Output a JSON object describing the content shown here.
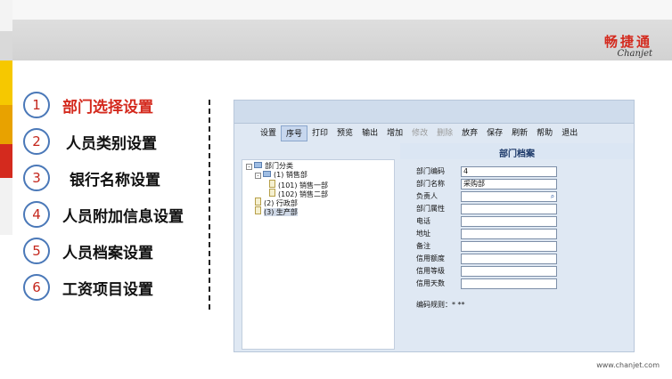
{
  "brand": {
    "name_cn": "畅捷通",
    "name_en": "Chanjet"
  },
  "menu": [
    {
      "number": "1",
      "label": "部门选择设置",
      "active": true
    },
    {
      "number": "2",
      "label": "人员类别设置",
      "active": false
    },
    {
      "number": "3",
      "label": "银行名称设置",
      "active": false
    },
    {
      "number": "4",
      "label": "人员附加信息设置",
      "active": false
    },
    {
      "number": "5",
      "label": "人员档案设置",
      "active": false
    },
    {
      "number": "6",
      "label": "工资项目设置",
      "active": false
    }
  ],
  "app": {
    "toolbar": [
      {
        "label": "设置",
        "state": "normal"
      },
      {
        "label": "序号",
        "state": "selected"
      },
      {
        "label": "打印",
        "state": "normal"
      },
      {
        "label": "预览",
        "state": "normal"
      },
      {
        "label": "输出",
        "state": "normal"
      },
      {
        "label": "增加",
        "state": "normal"
      },
      {
        "label": "修改",
        "state": "disabled"
      },
      {
        "label": "删除",
        "state": "disabled"
      },
      {
        "label": "放弃",
        "state": "normal"
      },
      {
        "label": "保存",
        "state": "normal"
      },
      {
        "label": "刷新",
        "state": "normal"
      },
      {
        "label": "帮助",
        "state": "normal"
      },
      {
        "label": "退出",
        "state": "normal"
      }
    ],
    "title": "部门档案",
    "tree": [
      {
        "text": "部门分类",
        "level": 0,
        "toggle": "-",
        "icon": "blue",
        "selected": false
      },
      {
        "text": "(1) 销售部",
        "level": 1,
        "toggle": "-",
        "icon": "blue",
        "selected": false
      },
      {
        "text": "(101) 销售一部",
        "level": 2,
        "toggle": "",
        "icon": "file",
        "selected": false
      },
      {
        "text": "(102) 销售二部",
        "level": 2,
        "toggle": "",
        "icon": "file",
        "selected": false
      },
      {
        "text": "(2) 行政部",
        "level": 1,
        "toggle": "",
        "icon": "file",
        "selected": false
      },
      {
        "text": "(3) 生产部",
        "level": 1,
        "toggle": "",
        "icon": "file",
        "selected": true
      }
    ],
    "form": {
      "fields": [
        {
          "label": "部门编码",
          "value": "4",
          "lookup": false
        },
        {
          "label": "部门名称",
          "value": "采购部",
          "lookup": false
        },
        {
          "label": "负责人",
          "value": "",
          "lookup": true
        },
        {
          "label": "部门属性",
          "value": "",
          "lookup": false
        },
        {
          "label": "电话",
          "value": "",
          "lookup": false
        },
        {
          "label": "地址",
          "value": "",
          "lookup": false
        },
        {
          "label": "备注",
          "value": "",
          "lookup": false
        },
        {
          "label": "信用额度",
          "value": "",
          "lookup": false
        },
        {
          "label": "信用等级",
          "value": "",
          "lookup": false
        },
        {
          "label": "信用天数",
          "value": "",
          "lookup": false
        }
      ],
      "rule": "编码规则：* **"
    }
  },
  "footer": {
    "url": "www.chanjet.com"
  },
  "colors": {
    "accent_red": "#d42a1e",
    "circle_border": "#4a78b8",
    "yellow": "#f6c800"
  }
}
